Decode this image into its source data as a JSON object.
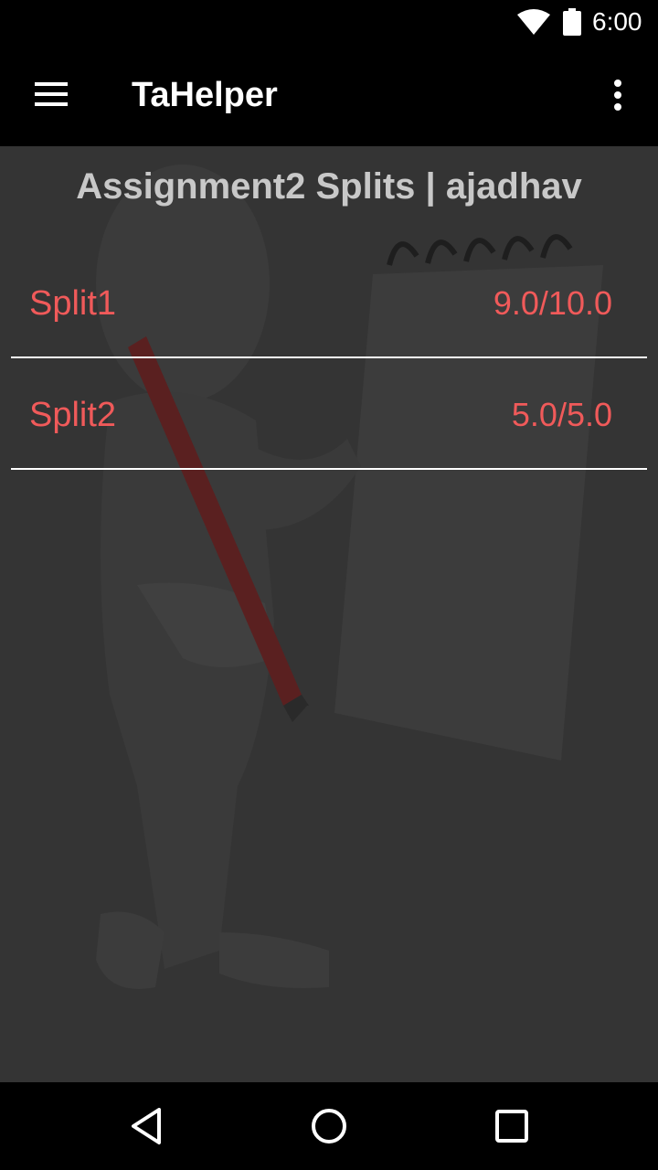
{
  "status_bar": {
    "time": "6:00",
    "icons": [
      "wifi-icon",
      "battery-icon"
    ]
  },
  "app_bar": {
    "title": "TaHelper",
    "icons": [
      "menu-icon",
      "overflow-menu-icon"
    ]
  },
  "page": {
    "title": "Assignment2 Splits | ajadhav",
    "splits": [
      {
        "name": "Split1",
        "score": "9.0/10.0"
      },
      {
        "name": "Split2",
        "score": "5.0/5.0"
      }
    ]
  },
  "nav_bar": {
    "icons": [
      "back-icon",
      "home-icon",
      "recents-icon"
    ]
  },
  "colors": {
    "accent_text": "#f05a5a",
    "content_bg": "#343434",
    "bars": "#000000"
  }
}
